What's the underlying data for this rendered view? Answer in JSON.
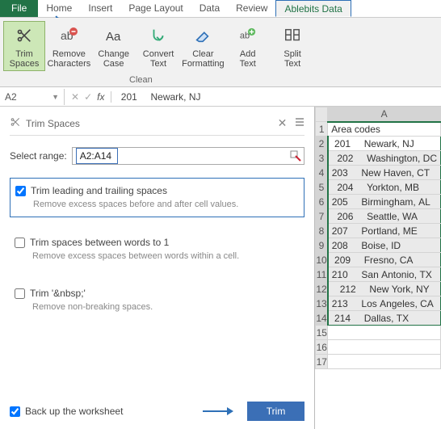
{
  "tabs": {
    "file": "File",
    "items": [
      "Home",
      "Insert",
      "Page Layout",
      "Data",
      "Review",
      "Ablebits Data"
    ],
    "active": "Ablebits Data"
  },
  "ribbon": {
    "trim_spaces": "Trim\nSpaces",
    "remove_chars": "Remove\nCharacters",
    "change_case": "Change\nCase",
    "convert_text": "Convert\nText",
    "clear_fmt": "Clear\nFormatting",
    "add_text": "Add\nText",
    "split_text": "Split\nText",
    "group_label": "Clean"
  },
  "formula_bar": {
    "namebox": "A2",
    "value": " 201     Newark, NJ"
  },
  "pane": {
    "title": "Trim Spaces",
    "select_label": "Select range:",
    "range": "A2:A14",
    "opt1_label": "Trim leading and trailing spaces",
    "opt1_desc": "Remove excess spaces before and after cell values.",
    "opt2_label": "Trim spaces between words to 1",
    "opt2_desc": "Remove excess spaces between words within a cell.",
    "opt3_label": "Trim  '&nbsp;'",
    "opt3_desc": "Remove non-breaking spaces.",
    "backup_label": "Back up the worksheet",
    "trim_button": "Trim"
  },
  "grid": {
    "col_label": "A",
    "header": "Area codes",
    "rows": [
      {
        "n": 2,
        "v": " 201     Newark, NJ"
      },
      {
        "n": 3,
        "v": "  202     Washington, DC"
      },
      {
        "n": 4,
        "v": "203     New Haven, CT"
      },
      {
        "n": 5,
        "v": "  204     Yorkton, MB"
      },
      {
        "n": 6,
        "v": "205     Birmingham, AL"
      },
      {
        "n": 7,
        "v": "  206     Seattle, WA"
      },
      {
        "n": 8,
        "v": "207     Portland, ME"
      },
      {
        "n": 9,
        "v": "208     Boise, ID"
      },
      {
        "n": 10,
        "v": " 209     Fresno, CA"
      },
      {
        "n": 11,
        "v": "210     San Antonio, TX"
      },
      {
        "n": 12,
        "v": "   212     New York, NY"
      },
      {
        "n": 13,
        "v": "213     Los Angeles, CA"
      },
      {
        "n": 14,
        "v": " 214     Dallas, TX"
      }
    ],
    "empty_rows": [
      15,
      16,
      17
    ]
  }
}
